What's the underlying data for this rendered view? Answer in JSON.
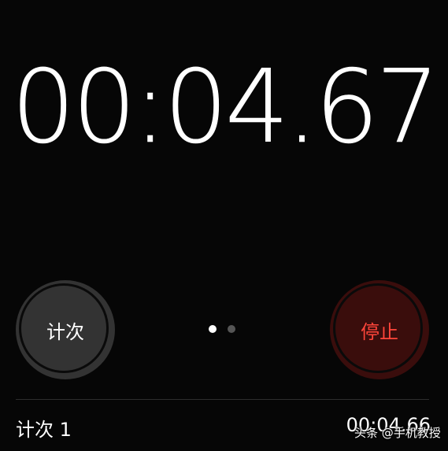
{
  "timer": {
    "display": "00:04.67"
  },
  "buttons": {
    "lap_label": "计次",
    "stop_label": "停止"
  },
  "page_indicator": {
    "total": 2,
    "active_index": 0
  },
  "laps": [
    {
      "name": "计次 1",
      "time": "00:04.66"
    }
  ],
  "watermark": "头条 @手机教授",
  "colors": {
    "background": "#060606",
    "lap_button": "#333333",
    "stop_button_bg": "#3a0d0c",
    "stop_text": "#ff453a"
  }
}
